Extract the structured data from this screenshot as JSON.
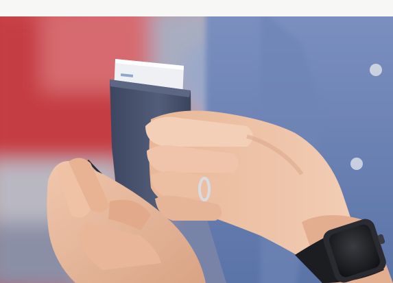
{
  "image": {
    "kind": "photo",
    "subject": "hands-holding-card-wallet",
    "colors": {
      "top_strip": "#f7f7f5",
      "background_red": "#c9474a",
      "background_pink": "#d9878e",
      "shirt_blue": "#6f87b8",
      "wallet_navy": "#4a5570",
      "card_white": "#eef0f4",
      "skin": "#e7b79a",
      "watch_black": "#1c1d21"
    }
  }
}
